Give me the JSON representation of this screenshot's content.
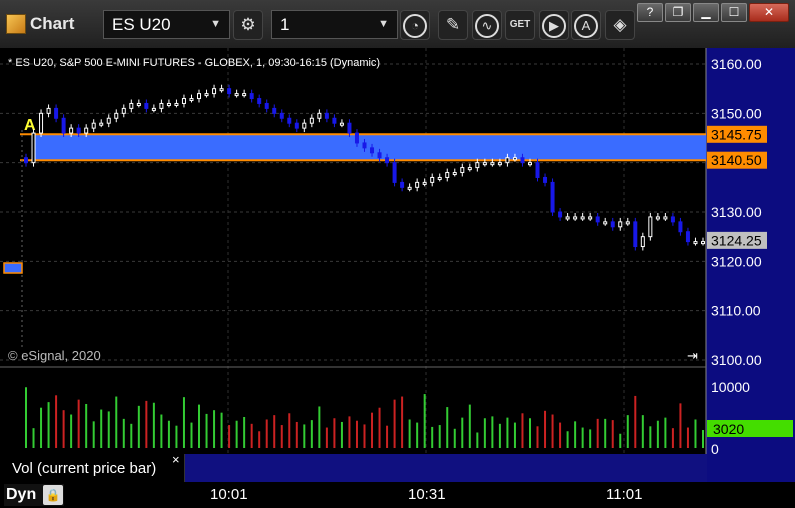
{
  "window": {
    "app_title": "Chart"
  },
  "toolbar": {
    "symbol": "ES U20",
    "interval": "1",
    "symbol_tag": "GET"
  },
  "chart": {
    "header_text": "* ES U20, S&P 500 E-MINI FUTURES - GLOBEX, 1, 09:30-16:15 (Dynamic)",
    "copyright": "© eSignal, 2020",
    "annotation_label": "A",
    "price_axis": [
      "3160.00",
      "3150.00",
      "3140.00",
      "3130.00",
      "3120.00",
      "3110.00",
      "3100.00"
    ],
    "price_tags": {
      "upper": "3145.75",
      "lower": "3140.50",
      "last": "3124.25"
    },
    "volume_axis": [
      "10000",
      "0"
    ],
    "volume_tag": "3020",
    "volume_legend": "Vol (current price bar)",
    "time_axis": [
      "10:01",
      "10:31",
      "11:01"
    ],
    "dyn_label": "Dyn",
    "colors": {
      "up_candle": "#ffffff",
      "down_candle": "#1818e8",
      "zone_fill": "#3a6cff",
      "zone_line": "#ff8c00",
      "last_price_tag": "#c0c0c0",
      "volume_tag": "#44dd00"
    }
  },
  "chart_data": {
    "type": "candlestick",
    "ylabel": "",
    "ylim": [
      3100,
      3162
    ],
    "zone": [
      3140.5,
      3145.75
    ],
    "last_price": 3124.25,
    "time_labels": [
      "10:01",
      "10:31",
      "11:01"
    ],
    "closes": [
      3140,
      3146,
      3150,
      3151,
      3149,
      3146,
      3147,
      3146,
      3147,
      3148,
      3148,
      3149,
      3150,
      3151,
      3152,
      3152,
      3151,
      3151,
      3152,
      3152,
      3152,
      3153,
      3153,
      3154,
      3154,
      3155,
      3155,
      3154,
      3154,
      3154,
      3153,
      3152,
      3151,
      3150,
      3149,
      3148,
      3147,
      3148,
      3149,
      3150,
      3149,
      3148,
      3148,
      3146,
      3144,
      3143,
      3142,
      3141,
      3140,
      3136,
      3135,
      3135,
      3136,
      3136,
      3137,
      3137,
      3138,
      3138,
      3139,
      3139,
      3140,
      3140,
      3140,
      3140,
      3141,
      3141,
      3140,
      3140,
      3137,
      3136,
      3130,
      3129,
      3129,
      3129,
      3129,
      3129,
      3128,
      3128,
      3127,
      3128,
      3128,
      3123,
      3125,
      3129,
      3129,
      3129,
      3128,
      3126,
      3124,
      3124,
      3124
    ],
    "volume_max_scale": 10000,
    "volumes": [
      9800,
      3200,
      6500,
      7400,
      8500,
      6100,
      5400,
      7800,
      7100,
      4300,
      6200,
      5900,
      8300,
      4700,
      3900,
      6800,
      7600,
      7300,
      5400,
      4400,
      3600,
      8200,
      4100,
      7000,
      5500,
      6100,
      5700,
      3700,
      4400,
      5000,
      3900,
      2700,
      4600,
      5300,
      3700,
      5600,
      4200,
      3800,
      4500,
      6700,
      3300,
      4800,
      4200,
      5100,
      4400,
      3800,
      5700,
      6500,
      3600,
      7800,
      8300,
      4600,
      4100,
      8700,
      3400,
      3700,
      6600,
      3100,
      4900,
      7000,
      2500,
      4800,
      5100,
      3900,
      4900,
      4100,
      5600,
      4800,
      3500,
      6000,
      5400,
      4100,
      2700,
      4300,
      3300,
      3000,
      4700,
      4700,
      4500,
      2300,
      5300,
      8400,
      5300,
      3500,
      4400,
      4900,
      3200,
      7200,
      3300,
      4600,
      2900
    ]
  }
}
